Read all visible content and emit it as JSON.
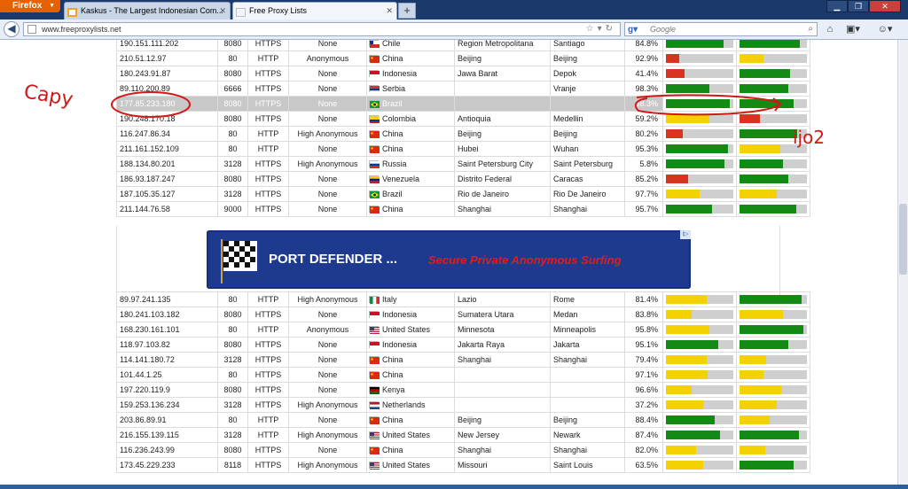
{
  "browser": {
    "firefox_label": "Firefox",
    "tabs": [
      {
        "label": "Kaskus - The Largest Indonesian Com...",
        "active": false
      },
      {
        "label": "Free Proxy Lists",
        "active": true
      }
    ],
    "new_tab": "+",
    "url": "www.freeproxylists.net",
    "search_placeholder": "Google",
    "search_engine_icon": "g-icon",
    "window_buttons": [
      "minimize",
      "maximize",
      "close"
    ]
  },
  "colors": {
    "bar_green": "#138a13",
    "bar_yellow": "#f4d100",
    "bar_red": "#d8341f",
    "bar_track": "#cfcfcf"
  },
  "table_top": {
    "rows": [
      {
        "ip": "190.151.111.202",
        "port": "8080",
        "type": "HTTPS",
        "anon": "None",
        "country": "Chile",
        "flag": "cl",
        "region": "Region Metropolitana",
        "city": "Santiago",
        "uptime": "84.8%",
        "resp": {
          "level": 0.85,
          "color": "green"
        },
        "trans": {
          "level": 0.9,
          "color": "green"
        }
      },
      {
        "ip": "210.51.12.97",
        "port": "80",
        "type": "HTTP",
        "anon": "Anonymous",
        "country": "China",
        "flag": "cn",
        "region": "Beijing",
        "city": "Beijing",
        "uptime": "92.9%",
        "resp": {
          "level": 0.2,
          "color": "red"
        },
        "trans": {
          "level": 0.35,
          "color": "yellow"
        }
      },
      {
        "ip": "180.243.91.87",
        "port": "8080",
        "type": "HTTPS",
        "anon": "None",
        "country": "Indonesia",
        "flag": "id",
        "region": "Jawa Barat",
        "city": "Depok",
        "uptime": "41.4%",
        "resp": {
          "level": 0.28,
          "color": "red"
        },
        "trans": {
          "level": 0.75,
          "color": "green"
        }
      },
      {
        "ip": "89.110.200.89",
        "port": "6666",
        "type": "HTTPS",
        "anon": "None",
        "country": "Serbia",
        "flag": "rs",
        "region": "",
        "city": "Vranje",
        "uptime": "98.3%",
        "resp": {
          "level": 0.65,
          "color": "green"
        },
        "trans": {
          "level": 0.72,
          "color": "green"
        }
      },
      {
        "ip": "177.85.233.180",
        "port": "8080",
        "type": "HTTPS",
        "anon": "None",
        "country": "Brazil",
        "flag": "br",
        "region": "",
        "city": "",
        "uptime": "98.3%",
        "resp": {
          "level": 0.95,
          "color": "green"
        },
        "trans": {
          "level": 0.8,
          "color": "green"
        },
        "highlight": true
      },
      {
        "ip": "190.248.170.18",
        "port": "8080",
        "type": "HTTPS",
        "anon": "None",
        "country": "Colombia",
        "flag": "co",
        "region": "Antioquia",
        "city": "Medellin",
        "uptime": "59.2%",
        "resp": {
          "level": 0.65,
          "color": "yellow"
        },
        "trans": {
          "level": 0.3,
          "color": "red"
        }
      },
      {
        "ip": "116.247.86.34",
        "port": "80",
        "type": "HTTP",
        "anon": "High Anonymous",
        "country": "China",
        "flag": "cn",
        "region": "Beijing",
        "city": "Beijing",
        "uptime": "80.2%",
        "resp": {
          "level": 0.25,
          "color": "red"
        },
        "trans": {
          "level": 0.85,
          "color": "green"
        }
      },
      {
        "ip": "211.161.152.109",
        "port": "80",
        "type": "HTTP",
        "anon": "None",
        "country": "China",
        "flag": "cn",
        "region": "Hubei",
        "city": "Wuhan",
        "uptime": "95.3%",
        "resp": {
          "level": 0.92,
          "color": "green"
        },
        "trans": {
          "level": 0.6,
          "color": "yellow"
        }
      },
      {
        "ip": "188.134.80.201",
        "port": "3128",
        "type": "HTTPS",
        "anon": "High Anonymous",
        "country": "Russia",
        "flag": "ru",
        "region": "Saint Petersburg City",
        "city": "Saint Petersburg",
        "uptime": "5.8%",
        "resp": {
          "level": 0.87,
          "color": "green"
        },
        "trans": {
          "level": 0.65,
          "color": "green"
        }
      },
      {
        "ip": "186.93.187.247",
        "port": "8080",
        "type": "HTTPS",
        "anon": "None",
        "country": "Venezuela",
        "flag": "ve",
        "region": "Distrito Federal",
        "city": "Caracas",
        "uptime": "85.2%",
        "resp": {
          "level": 0.33,
          "color": "red"
        },
        "trans": {
          "level": 0.73,
          "color": "green"
        }
      },
      {
        "ip": "187.105.35.127",
        "port": "3128",
        "type": "HTTPS",
        "anon": "None",
        "country": "Brazil",
        "flag": "br",
        "region": "Rio de Janeiro",
        "city": "Rio De Janeiro",
        "uptime": "97.7%",
        "resp": {
          "level": 0.5,
          "color": "yellow"
        },
        "trans": {
          "level": 0.55,
          "color": "yellow"
        }
      },
      {
        "ip": "211.144.76.58",
        "port": "9000",
        "type": "HTTPS",
        "anon": "None",
        "country": "China",
        "flag": "cn",
        "region": "Shanghai",
        "city": "Shanghai",
        "uptime": "95.7%",
        "resp": {
          "level": 0.68,
          "color": "green"
        },
        "trans": {
          "level": 0.84,
          "color": "green"
        }
      }
    ]
  },
  "ad": {
    "title": "PORT DEFENDER ...",
    "slogan": "Secure Private Anonymous Surfing",
    "adchoices": "i▷"
  },
  "table_bottom": {
    "rows": [
      {
        "ip": "89.97.241.135",
        "port": "80",
        "type": "HTTP",
        "anon": "High Anonymous",
        "country": "Italy",
        "flag": "it",
        "region": "Lazio",
        "city": "Rome",
        "uptime": "81.4%",
        "resp": {
          "level": 0.6,
          "color": "yellow"
        },
        "trans": {
          "level": 0.92,
          "color": "green"
        }
      },
      {
        "ip": "180.241.103.182",
        "port": "8080",
        "type": "HTTPS",
        "anon": "None",
        "country": "Indonesia",
        "flag": "id",
        "region": "Sumatera Utara",
        "city": "Medan",
        "uptime": "83.8%",
        "resp": {
          "level": 0.38,
          "color": "yellow"
        },
        "trans": {
          "level": 0.65,
          "color": "yellow"
        }
      },
      {
        "ip": "168.230.161.101",
        "port": "80",
        "type": "HTTP",
        "anon": "Anonymous",
        "country": "United States",
        "flag": "us",
        "region": "Minnesota",
        "city": "Minneapolis",
        "uptime": "95.8%",
        "resp": {
          "level": 0.65,
          "color": "yellow"
        },
        "trans": {
          "level": 0.95,
          "color": "green"
        }
      },
      {
        "ip": "118.97.103.82",
        "port": "8080",
        "type": "HTTPS",
        "anon": "None",
        "country": "Indonesia",
        "flag": "id",
        "region": "Jakarta Raya",
        "city": "Jakarta",
        "uptime": "95.1%",
        "resp": {
          "level": 0.78,
          "color": "green"
        },
        "trans": {
          "level": 0.72,
          "color": "green"
        }
      },
      {
        "ip": "114.141.180.72",
        "port": "3128",
        "type": "HTTPS",
        "anon": "None",
        "country": "China",
        "flag": "cn",
        "region": "Shanghai",
        "city": "Shanghai",
        "uptime": "79.4%",
        "resp": {
          "level": 0.6,
          "color": "yellow"
        },
        "trans": {
          "level": 0.4,
          "color": "yellow"
        }
      },
      {
        "ip": "101.44.1.25",
        "port": "80",
        "type": "HTTPS",
        "anon": "None",
        "country": "China",
        "flag": "cn",
        "region": "",
        "city": "",
        "uptime": "97.1%",
        "resp": {
          "level": 0.62,
          "color": "yellow"
        },
        "trans": {
          "level": 0.35,
          "color": "yellow"
        }
      },
      {
        "ip": "197.220.119.9",
        "port": "8080",
        "type": "HTTPS",
        "anon": "None",
        "country": "Kenya",
        "flag": "ke",
        "region": "",
        "city": "",
        "uptime": "96.6%",
        "resp": {
          "level": 0.38,
          "color": "yellow"
        },
        "trans": {
          "level": 0.62,
          "color": "yellow"
        }
      },
      {
        "ip": "159.253.136.234",
        "port": "3128",
        "type": "HTTPS",
        "anon": "High Anonymous",
        "country": "Netherlands",
        "flag": "nl",
        "region": "",
        "city": "",
        "uptime": "37.2%",
        "resp": {
          "level": 0.55,
          "color": "yellow"
        },
        "trans": {
          "level": 0.55,
          "color": "yellow"
        }
      },
      {
        "ip": "203.86.89.91",
        "port": "80",
        "type": "HTTP",
        "anon": "None",
        "country": "China",
        "flag": "cn",
        "region": "Beijing",
        "city": "Beijing",
        "uptime": "88.4%",
        "resp": {
          "level": 0.72,
          "color": "green"
        },
        "trans": {
          "level": 0.45,
          "color": "yellow"
        }
      },
      {
        "ip": "216.155.139.115",
        "port": "3128",
        "type": "HTTP",
        "anon": "High Anonymous",
        "country": "United States",
        "flag": "us",
        "region": "New Jersey",
        "city": "Newark",
        "uptime": "87.4%",
        "resp": {
          "level": 0.8,
          "color": "green"
        },
        "trans": {
          "level": 0.88,
          "color": "green"
        }
      },
      {
        "ip": "116.236.243.99",
        "port": "8080",
        "type": "HTTPS",
        "anon": "None",
        "country": "China",
        "flag": "cn",
        "region": "Shanghai",
        "city": "Shanghai",
        "uptime": "82.0%",
        "resp": {
          "level": 0.45,
          "color": "yellow"
        },
        "trans": {
          "level": 0.38,
          "color": "yellow"
        }
      },
      {
        "ip": "173.45.229.233",
        "port": "8118",
        "type": "HTTPS",
        "anon": "High Anonymous",
        "country": "United States",
        "flag": "us",
        "region": "Missouri",
        "city": "Saint Louis",
        "uptime": "63.5%",
        "resp": {
          "level": 0.55,
          "color": "yellow"
        },
        "trans": {
          "level": 0.8,
          "color": "green"
        }
      }
    ]
  },
  "annotations": {
    "left_note": "Capy",
    "right_note": "ijo2"
  }
}
